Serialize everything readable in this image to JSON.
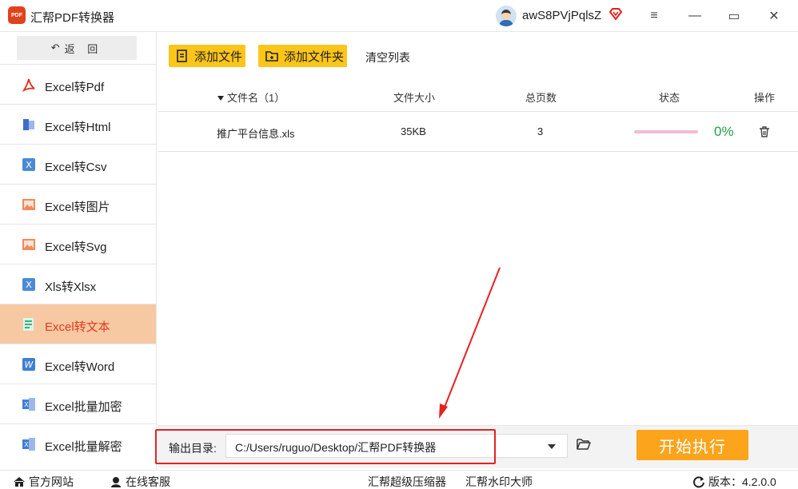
{
  "app": {
    "title": "汇帮PDF转换器",
    "logo_text": "PDF"
  },
  "user": {
    "name": "awS8PVjPqlsZ"
  },
  "window_controls": {
    "menu": "≡",
    "minimize": "—",
    "maximize": "▭",
    "close": "✕"
  },
  "sidebar": {
    "back_label": "返 回",
    "back_icon": "↶",
    "items": [
      {
        "label": "Excel转Pdf",
        "icon": "pdf-icon"
      },
      {
        "label": "Excel转Html",
        "icon": "html-icon"
      },
      {
        "label": "Excel转Csv",
        "icon": "csv-icon"
      },
      {
        "label": "Excel转图片",
        "icon": "image-icon"
      },
      {
        "label": "Excel转Svg",
        "icon": "svg-icon"
      },
      {
        "label": "Xls转Xlsx",
        "icon": "xlsx-icon"
      },
      {
        "label": "Excel转文本",
        "icon": "text-icon",
        "active": true
      },
      {
        "label": "Excel转Word",
        "icon": "word-icon"
      },
      {
        "label": "Excel批量加密",
        "icon": "encrypt-icon"
      },
      {
        "label": "Excel批量解密",
        "icon": "decrypt-icon"
      }
    ]
  },
  "toolbar": {
    "add_file": "添加文件",
    "add_folder": "添加文件夹",
    "clear_list": "清空列表"
  },
  "table": {
    "headers": {
      "name": "文件名（1）",
      "size": "文件大小",
      "pages": "总页数",
      "status": "状态",
      "action": "操作"
    },
    "rows": [
      {
        "name": "推广平台信息.xls",
        "size": "35KB",
        "pages": "3",
        "progress": 0,
        "percent": "0%"
      }
    ]
  },
  "output": {
    "label": "输出目录:",
    "path": "C:/Users/ruguo/Desktop/汇帮PDF转换器",
    "start_label": "开始执行"
  },
  "statusbar": {
    "website": "官方网站",
    "service": "在线客服",
    "compressor": "汇帮超级压缩器",
    "watermark": "汇帮水印大师",
    "version": "版本：4.2.0.0"
  },
  "colors": {
    "accent_orange": "#fba41c",
    "button_yellow": "#fcc51a",
    "active_bg": "#f7c9a3",
    "active_text": "#e03a1e",
    "annotation_red": "#e52222",
    "percent_green": "#20a046"
  }
}
